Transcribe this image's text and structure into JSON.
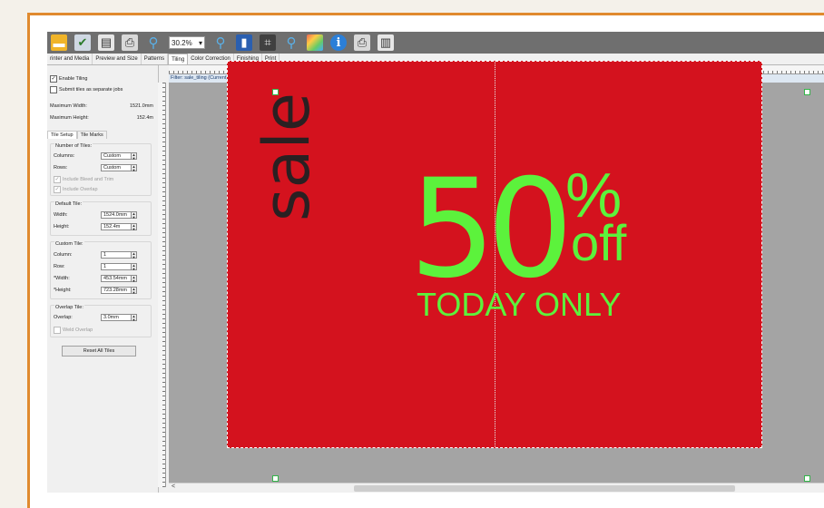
{
  "toolbar": {
    "zoom_value": "30.2%"
  },
  "tabs": [
    {
      "label": "rinter and Media"
    },
    {
      "label": "Preview and Size"
    },
    {
      "label": "Patterns"
    },
    {
      "label": "Tiling"
    },
    {
      "label": "Color Correction"
    },
    {
      "label": "Finishing"
    },
    {
      "label": "Print"
    }
  ],
  "panel": {
    "enable_tiling": "Enable Tiling",
    "submit_separate": "Submit tiles as separate jobs",
    "max_width_label": "Maximum Width:",
    "max_width_value": "1521.0mm",
    "max_height_label": "Maximum Height:",
    "max_height_value": "152.4m",
    "subtabs": [
      "Tile Setup",
      "Tile Marks"
    ],
    "number_of_tiles": {
      "title": "Number of Tiles:",
      "columns_label": "Columns:",
      "columns_value": "Custom",
      "rows_label": "Rows:",
      "rows_value": "Custom",
      "include_bleed": "Include Bleed and Trim",
      "include_overlap": "Include Overlap"
    },
    "default_tile": {
      "title": "Default Tile:",
      "width_label": "Width:",
      "width_value": "1524.0mm",
      "height_label": "Height:",
      "height_value": "152.4m"
    },
    "custom_tile": {
      "title": "Custom Tile:",
      "column_label": "Column:",
      "column_value": "1",
      "row_label": "Row:",
      "row_value": "1",
      "width_label": "*Width:",
      "width_value": "453.54mm",
      "height_label": "*Height:",
      "height_value": "723.28mm"
    },
    "overlap_tile": {
      "title": "Overlap Tile:",
      "overlap_label": "Overlap:",
      "overlap_value": "3.0mm",
      "weld_overlap": "Weld Overlap"
    },
    "reset_button": "Reset All Tiles"
  },
  "workspace": {
    "filter_label": "Filter: sale_tiling (Current)"
  },
  "poster": {
    "sale": "sale",
    "fifty": "50",
    "percent": "%",
    "off": "off",
    "today": "TODAY ONLY"
  },
  "colors": {
    "poster_bg": "#d4121e",
    "accent_green": "#5cf23c",
    "frame_orange": "#e08a2e"
  }
}
